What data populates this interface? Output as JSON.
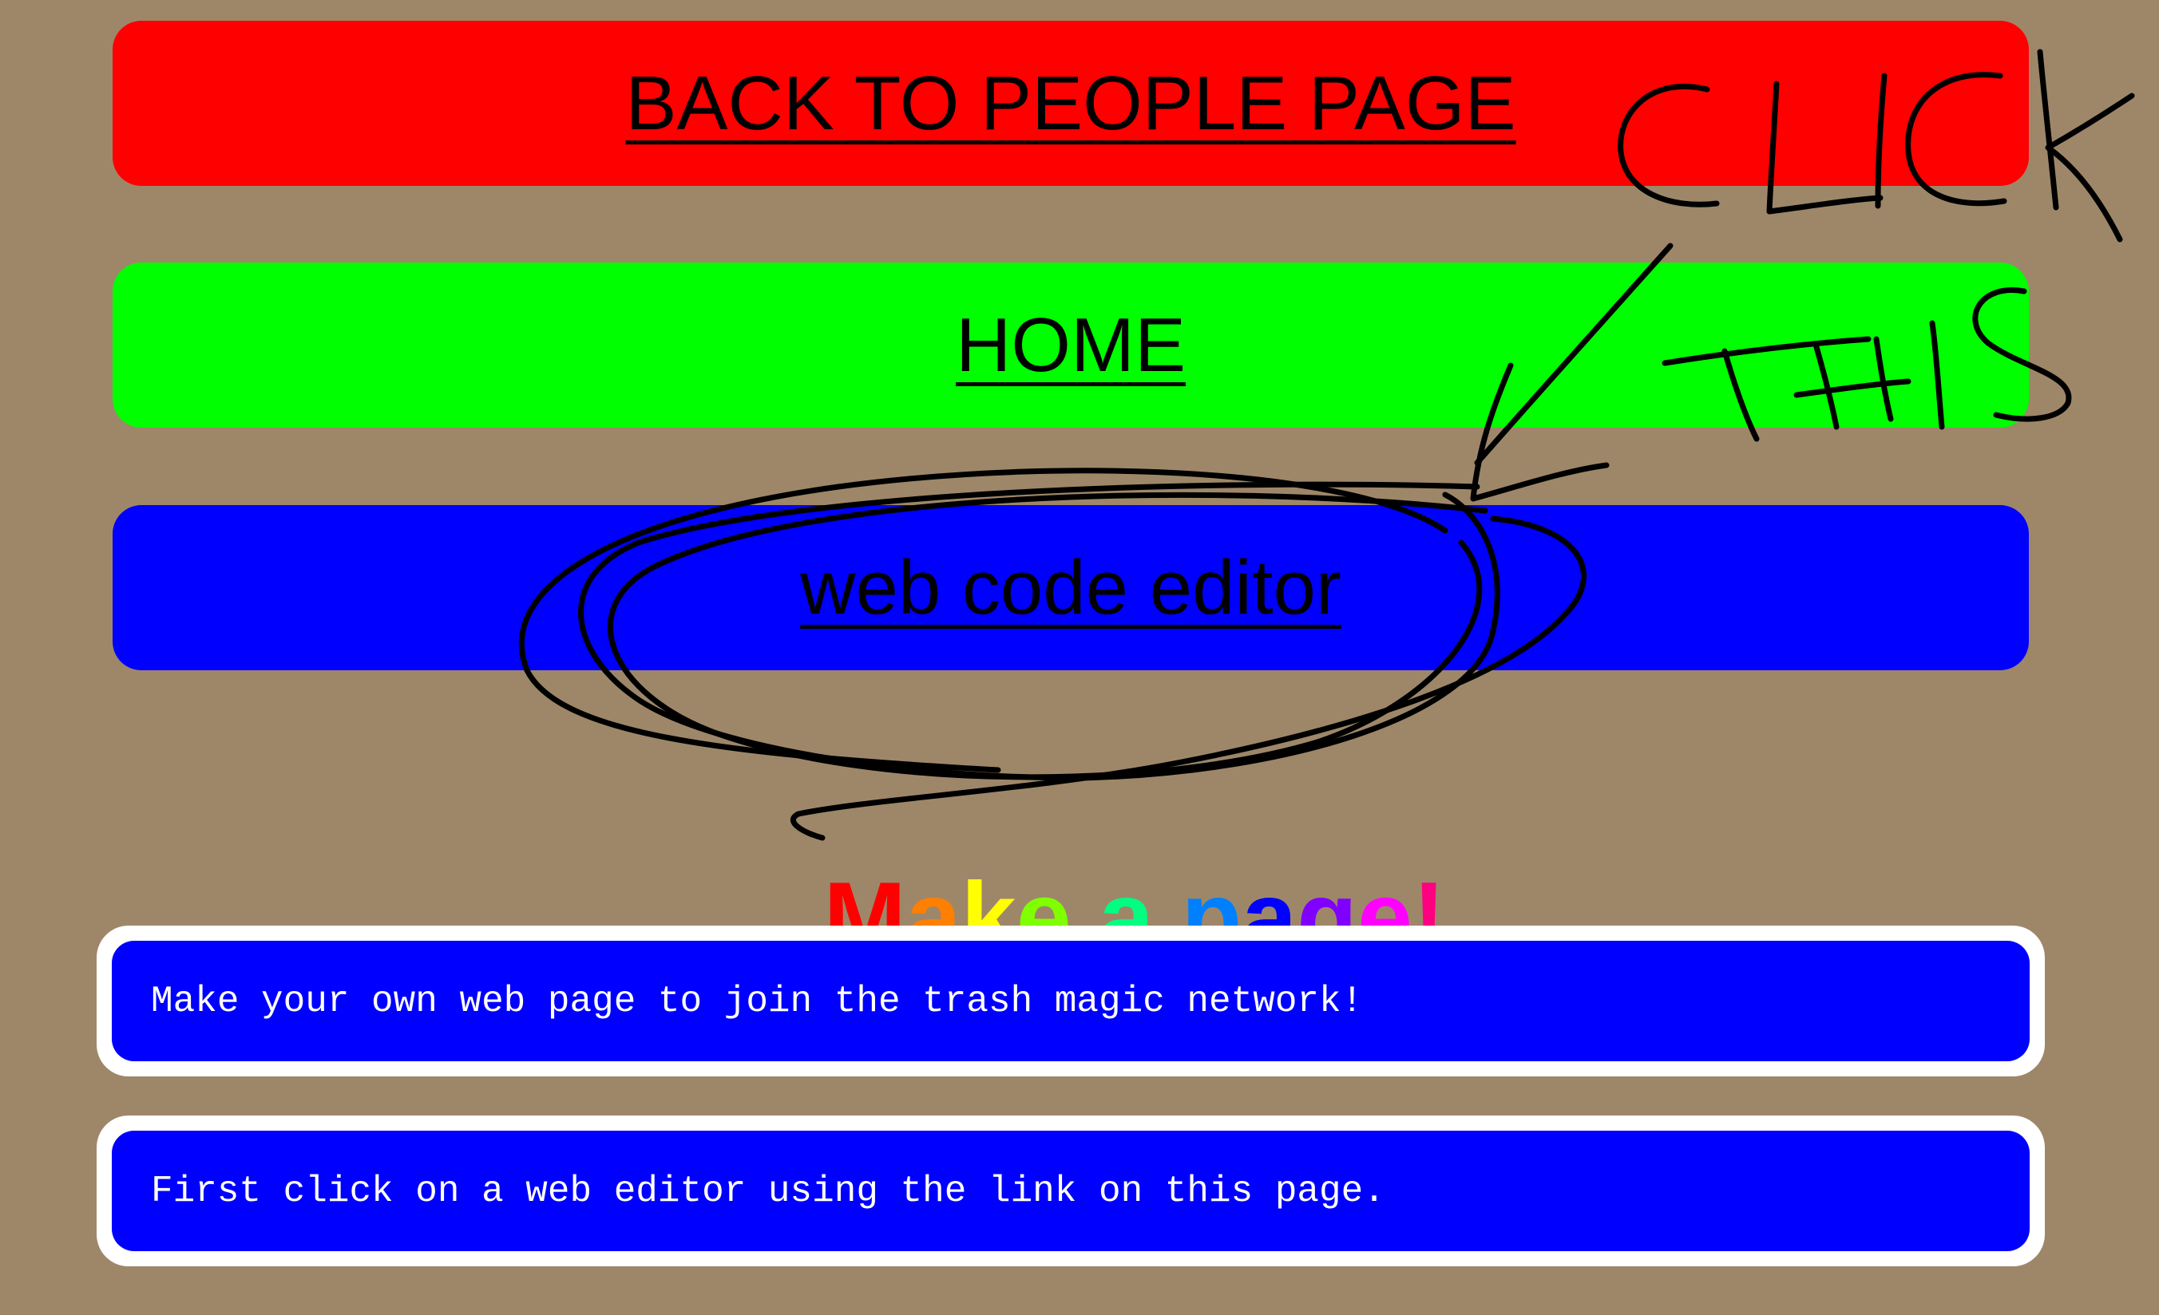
{
  "nav": {
    "back_label": "BACK TO PEOPLE PAGE",
    "home_label": "HOME",
    "editor_label": "web code editor",
    "colors": {
      "back": "#ff0000",
      "home": "#00ff00",
      "editor": "#0000ff"
    }
  },
  "title": {
    "letters": [
      {
        "ch": "M",
        "color": "#ff0000"
      },
      {
        "ch": "a",
        "color": "#ff8000"
      },
      {
        "ch": "k",
        "color": "#ffff00"
      },
      {
        "ch": "e",
        "color": "#80ff00"
      },
      {
        "ch": " ",
        "color": "#000000"
      },
      {
        "ch": "a",
        "color": "#00ff80"
      },
      {
        "ch": " ",
        "color": "#000000"
      },
      {
        "ch": "p",
        "color": "#0080ff"
      },
      {
        "ch": "a",
        "color": "#0000ff"
      },
      {
        "ch": "g",
        "color": "#8000ff"
      },
      {
        "ch": "e",
        "color": "#ff00ff"
      },
      {
        "ch": "!",
        "color": "#ff0080"
      }
    ]
  },
  "info": {
    "line1": "Make your own web page to join the trash magic network!",
    "line2": "First click on a web editor using the link on this page."
  },
  "annotation": {
    "word1": "CLICK",
    "word2": "THIS"
  }
}
